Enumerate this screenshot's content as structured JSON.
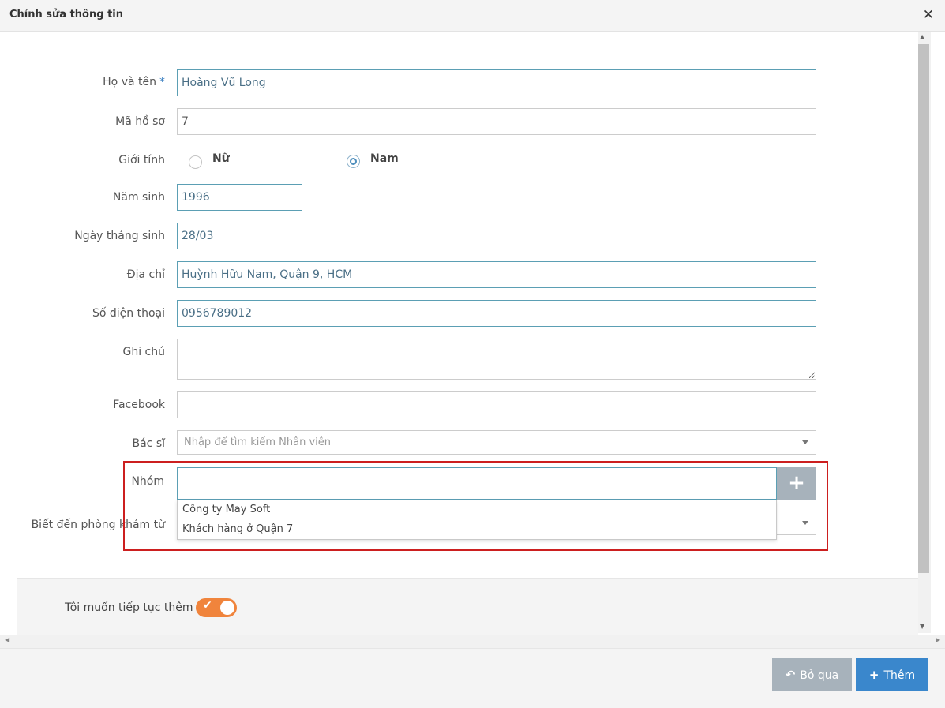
{
  "dialog": {
    "title": "Chỉnh sửa thông tin",
    "close_icon": "close-icon"
  },
  "form": {
    "full_name": {
      "label": "Họ và tên",
      "required_mark": "*",
      "value": "Hoàng Vũ Long"
    },
    "record_code": {
      "label": "Mã hồ sơ",
      "value": "7"
    },
    "gender": {
      "label": "Giới tính",
      "options": [
        "Nữ",
        "Nam"
      ],
      "selected": "Nam"
    },
    "birth_year": {
      "label": "Năm sinh",
      "value": "1996"
    },
    "birth_date": {
      "label": "Ngày tháng sinh",
      "value": "28/03"
    },
    "address": {
      "label": "Địa chỉ",
      "value": "Huỳnh Hữu Nam, Quận 9, HCM"
    },
    "phone": {
      "label": "Số điện thoại",
      "value": "0956789012"
    },
    "note": {
      "label": "Ghi chú",
      "value": ""
    },
    "facebook": {
      "label": "Facebook",
      "value": ""
    },
    "doctor": {
      "label": "Bác sĩ",
      "placeholder": "Nhập để tìm kiếm Nhân viên"
    },
    "group": {
      "label": "Nhóm",
      "value": "",
      "add_icon": "plus-icon",
      "options": [
        "Công ty May Soft",
        "Khách hàng ở Quận 7"
      ]
    },
    "referral": {
      "label": "Biết đến phòng khám từ"
    }
  },
  "footer": {
    "continue_label": "Tôi muốn tiếp tục thêm",
    "continue_enabled": true
  },
  "actions": {
    "skip_label": "Bỏ qua",
    "skip_icon": "undo-icon",
    "add_label": "Thêm",
    "add_icon": "plus-icon"
  },
  "colors": {
    "accent": "#3a87cc",
    "toggle": "#f0843c",
    "highlight_border": "#cc1f1f",
    "disabled_button": "#a7b2bb"
  }
}
